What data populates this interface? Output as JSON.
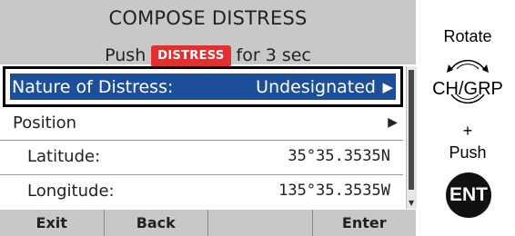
{
  "header": {
    "title": "COMPOSE DISTRESS",
    "push_prefix": "Push",
    "distress_badge": "DISTRESS",
    "push_suffix": "for 3 sec"
  },
  "menu": {
    "selected": {
      "label": "Nature of Distress:",
      "value": "Undesignated"
    },
    "position_label": "Position",
    "latitude": {
      "label": "Latitude:",
      "value": "35°35.3535N"
    },
    "longitude": {
      "label": "Longitude:",
      "value": "135°35.3535W"
    }
  },
  "softkeys": [
    "Exit",
    "Back",
    "",
    "Enter"
  ],
  "side_panel": {
    "rotate": "Rotate",
    "knob": "CH/GRP",
    "plus": "+",
    "push": "Push",
    "enter_button": "ENT"
  },
  "colors": {
    "header_bg": "#c8c8c8",
    "selection_bg": "#1c4f9a",
    "distress_badge": "#e23030"
  },
  "icons": {
    "arrow": "triangle-right-icon",
    "knob": "rotary-knob-icon"
  }
}
